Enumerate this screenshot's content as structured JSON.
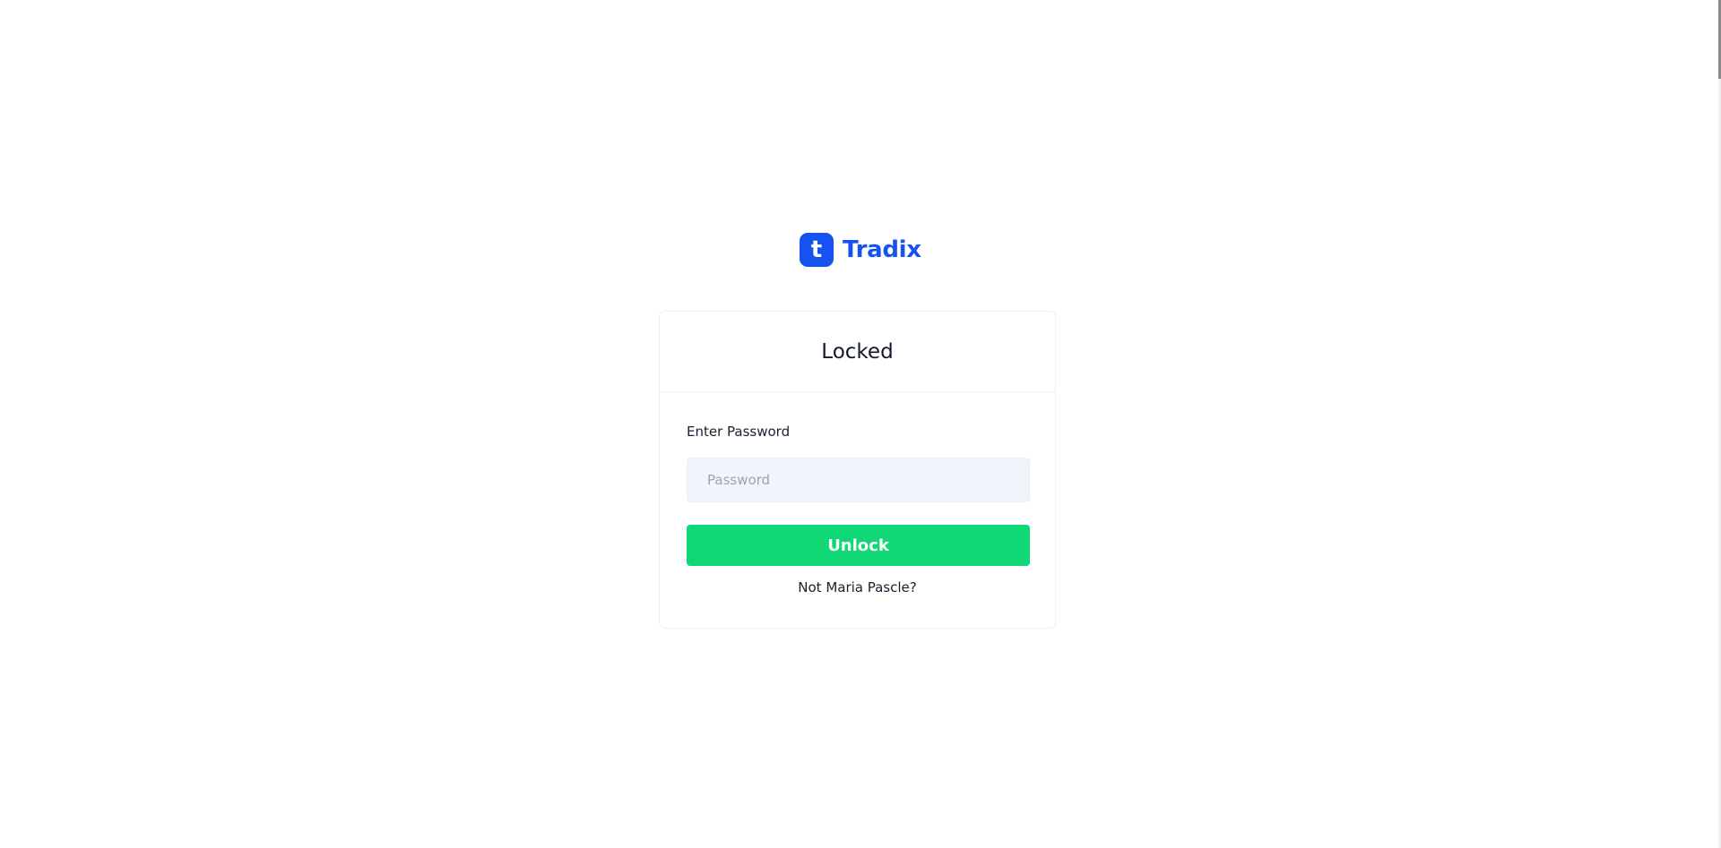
{
  "brand": {
    "logo_letter": "t",
    "name": "Tradix",
    "color": "#1652f0"
  },
  "card": {
    "title": "Locked",
    "password_label": "Enter Password",
    "password_placeholder": "Password",
    "password_value": "",
    "unlock_label": "Unlock",
    "unlock_color": "#10d876",
    "not_user_link": "Not Maria Pascle?"
  }
}
